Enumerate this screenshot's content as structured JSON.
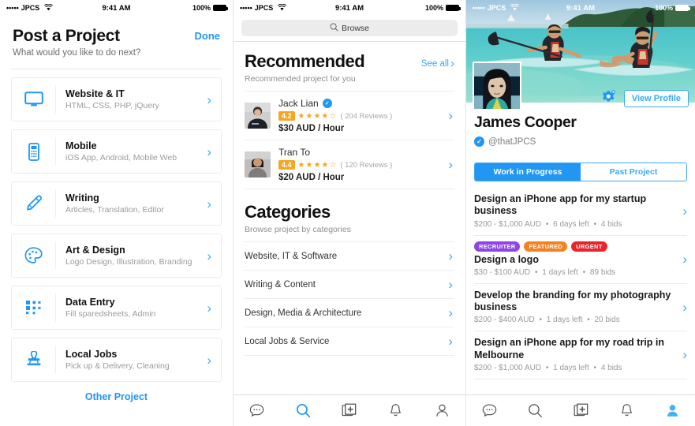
{
  "statusbar": {
    "carrier": "JPCS",
    "dots": "•••••",
    "wifi_icon": "wifi-icon",
    "time": "9:41 AM",
    "battery": "100%"
  },
  "panel1": {
    "title": "Post a Project",
    "subtitle": "What would you like to do next?",
    "done_label": "Done",
    "other_project_label": "Other Project",
    "items": [
      {
        "icon": "monitor-icon",
        "title": "Website & IT",
        "subtitle": "HTML, CSS, PHP, jQuery"
      },
      {
        "icon": "mobile-phone-icon",
        "title": "Mobile",
        "subtitle": "iOS App, Android, Mobile Web"
      },
      {
        "icon": "pencil-icon",
        "title": "Writing",
        "subtitle": "Articles, Translation, Editor"
      },
      {
        "icon": "palette-icon",
        "title": "Art & Design",
        "subtitle": "Logo Design, Illustration, Branding"
      },
      {
        "icon": "grid-dots-icon",
        "title": "Data Entry",
        "subtitle": "Fill sparedsheets, Admin"
      },
      {
        "icon": "stamp-icon",
        "title": "Local Jobs",
        "subtitle": "Pick up & Delivery, Cleaning"
      }
    ]
  },
  "panel2": {
    "search_placeholder": "Browse",
    "recommended": {
      "title": "Recommended",
      "subtitle": "Recommended project for you",
      "see_all_label": "See all",
      "freelancers": [
        {
          "name": "Jack Lian",
          "verified": true,
          "rating": "4.2",
          "stars": "★★★★☆",
          "reviews": "( 204 Reviews )",
          "price": "$30 AUD / Hour"
        },
        {
          "name": "Tran To",
          "verified": false,
          "rating": "4.4",
          "stars": "★★★★☆",
          "reviews": "( 120 Reviews )",
          "price": "$20 AUD / Hour"
        }
      ]
    },
    "categories": {
      "title": "Categories",
      "subtitle": "Browse project by categories",
      "items": [
        "Website, IT & Software",
        "Writing & Content",
        "Design, Media & Architecture",
        "Local Jobs & Service"
      ]
    },
    "tabbar": {
      "active": "search",
      "items": [
        "chat-icon",
        "search-icon",
        "post-project-icon",
        "notification-bell-icon",
        "profile-icon"
      ]
    }
  },
  "panel3": {
    "view_profile_label": "View Profile",
    "settings_icon": "gear-icon",
    "name": "James Cooper",
    "handle": "@thatJPCS",
    "tabs": [
      {
        "label": "Work in Progress",
        "active": true
      },
      {
        "label": "Past Project",
        "active": false
      }
    ],
    "projects": [
      {
        "tags": [],
        "title": "Design an iPhone app for my startup business",
        "budget": "$200 - $1,000 AUD",
        "time_left": "6 days left",
        "bids": "4 bids"
      },
      {
        "tags": [
          {
            "label": "RECRUITER",
            "color": "#8e44e8"
          },
          {
            "label": "FEATURED",
            "color": "#f58220"
          },
          {
            "label": "URGENT",
            "color": "#e8252b"
          }
        ],
        "title": "Design a logo",
        "budget": "$30 - $100 AUD",
        "time_left": "1 days left",
        "bids": "89 bids"
      },
      {
        "tags": [],
        "title": "Develop the branding for my photography business",
        "budget": "$200 - $400 AUD",
        "time_left": "1 days left",
        "bids": "20 bids"
      },
      {
        "tags": [],
        "title": "Design an iPhone app for my road trip in Melbourne",
        "budget": "$200 - $1,000 AUD",
        "time_left": "1 days left",
        "bids": "4 bids"
      }
    ],
    "tabbar": {
      "active": "profile",
      "items": [
        "chat-icon",
        "search-icon",
        "post-project-icon",
        "notification-bell-icon",
        "profile-icon"
      ]
    }
  },
  "colors": {
    "accent": "#2196f3",
    "chevron": "#3aa9f5",
    "rating": "#f5a623"
  }
}
